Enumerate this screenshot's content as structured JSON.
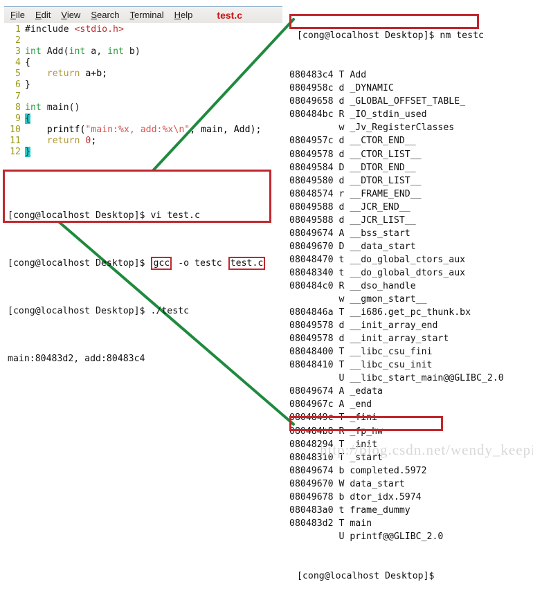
{
  "editor": {
    "menu": [
      {
        "label": "File",
        "accel": "F"
      },
      {
        "label": "Edit",
        "accel": "E"
      },
      {
        "label": "View",
        "accel": "V"
      },
      {
        "label": "Search",
        "accel": "S"
      },
      {
        "label": "Terminal",
        "accel": "T"
      },
      {
        "label": "Help",
        "accel": "H"
      }
    ],
    "document_label": "test.c",
    "code_lines": [
      {
        "num": "1",
        "text": "#include <stdio.h>"
      },
      {
        "num": "2",
        "text": ""
      },
      {
        "num": "3",
        "text": "int Add(int a, int b)"
      },
      {
        "num": "4",
        "text": "{"
      },
      {
        "num": "5",
        "text": "    return a+b;"
      },
      {
        "num": "6",
        "text": "}"
      },
      {
        "num": "7",
        "text": ""
      },
      {
        "num": "8",
        "text": "int main()"
      },
      {
        "num": "9",
        "text": "{"
      },
      {
        "num": "10",
        "text": "    printf(\"main:%x, add:%x\\n\", main, Add);"
      },
      {
        "num": "11",
        "text": "    return 0;"
      },
      {
        "num": "12",
        "text": "}"
      }
    ]
  },
  "terminal": {
    "lines": [
      "[cong@localhost Desktop]$ vi test.c",
      "[cong@localhost Desktop]$ gcc -o testc test.c",
      "[cong@localhost Desktop]$ ./testc",
      "main:80483d2, add:80483c4"
    ],
    "prompt": "[cong@localhost Desktop]$",
    "cmd_vi": "vi test.c",
    "cmd_gcc_tool": "gcc",
    "cmd_gcc_mid": " -o testc ",
    "cmd_gcc_src": "test.c",
    "cmd_run": "./testc",
    "program_output": "main:80483d2, add:80483c4"
  },
  "nm": {
    "command_line": "[cong@localhost Desktop]$ nm testc",
    "trailing_prompt": "[cong@localhost Desktop]$",
    "rows": [
      {
        "addr": "080483c4",
        "type": "T",
        "name": "Add"
      },
      {
        "addr": "0804958c",
        "type": "d",
        "name": "_DYNAMIC"
      },
      {
        "addr": "08049658",
        "type": "d",
        "name": "_GLOBAL_OFFSET_TABLE_"
      },
      {
        "addr": "080484bc",
        "type": "R",
        "name": "_IO_stdin_used"
      },
      {
        "addr": "",
        "type": "w",
        "name": "_Jv_RegisterClasses"
      },
      {
        "addr": "0804957c",
        "type": "d",
        "name": "__CTOR_END__"
      },
      {
        "addr": "08049578",
        "type": "d",
        "name": "__CTOR_LIST__"
      },
      {
        "addr": "08049584",
        "type": "D",
        "name": "__DTOR_END__"
      },
      {
        "addr": "08049580",
        "type": "d",
        "name": "__DTOR_LIST__"
      },
      {
        "addr": "08048574",
        "type": "r",
        "name": "__FRAME_END__"
      },
      {
        "addr": "08049588",
        "type": "d",
        "name": "__JCR_END__"
      },
      {
        "addr": "08049588",
        "type": "d",
        "name": "__JCR_LIST__"
      },
      {
        "addr": "08049674",
        "type": "A",
        "name": "__bss_start"
      },
      {
        "addr": "08049670",
        "type": "D",
        "name": "__data_start"
      },
      {
        "addr": "08048470",
        "type": "t",
        "name": "__do_global_ctors_aux"
      },
      {
        "addr": "08048340",
        "type": "t",
        "name": "__do_global_dtors_aux"
      },
      {
        "addr": "080484c0",
        "type": "R",
        "name": "__dso_handle"
      },
      {
        "addr": "",
        "type": "w",
        "name": "__gmon_start__"
      },
      {
        "addr": "0804846a",
        "type": "T",
        "name": "__i686.get_pc_thunk.bx"
      },
      {
        "addr": "08049578",
        "type": "d",
        "name": "__init_array_end"
      },
      {
        "addr": "08049578",
        "type": "d",
        "name": "__init_array_start"
      },
      {
        "addr": "08048400",
        "type": "T",
        "name": "__libc_csu_fini"
      },
      {
        "addr": "08048410",
        "type": "T",
        "name": "__libc_csu_init"
      },
      {
        "addr": "",
        "type": "U",
        "name": "__libc_start_main@@GLIBC_2.0"
      },
      {
        "addr": "08049674",
        "type": "A",
        "name": "_edata"
      },
      {
        "addr": "0804967c",
        "type": "A",
        "name": "_end"
      },
      {
        "addr": "0804849c",
        "type": "T",
        "name": "_fini"
      },
      {
        "addr": "080484b8",
        "type": "R",
        "name": "_fp_hw"
      },
      {
        "addr": "08048294",
        "type": "T",
        "name": "_init"
      },
      {
        "addr": "08048310",
        "type": "T",
        "name": "_start"
      },
      {
        "addr": "08049674",
        "type": "b",
        "name": "completed.5972"
      },
      {
        "addr": "08049670",
        "type": "W",
        "name": "data_start"
      },
      {
        "addr": "08049678",
        "type": "b",
        "name": "dtor_idx.5974"
      },
      {
        "addr": "080483a0",
        "type": "t",
        "name": "frame_dummy"
      },
      {
        "addr": "080483d2",
        "type": "T",
        "name": "main"
      },
      {
        "addr": "",
        "type": "U",
        "name": "printf@@GLIBC_2.0"
      }
    ]
  },
  "annotations": {
    "highlight_color": "#c0272d",
    "arrow_color": "#1f8a3d",
    "boxed_symbols": [
      "Add",
      "main"
    ],
    "boxed_terminal_tokens": [
      "gcc",
      "test.c"
    ]
  },
  "watermark": "http://blog.csdn.net/wendy_keeping"
}
